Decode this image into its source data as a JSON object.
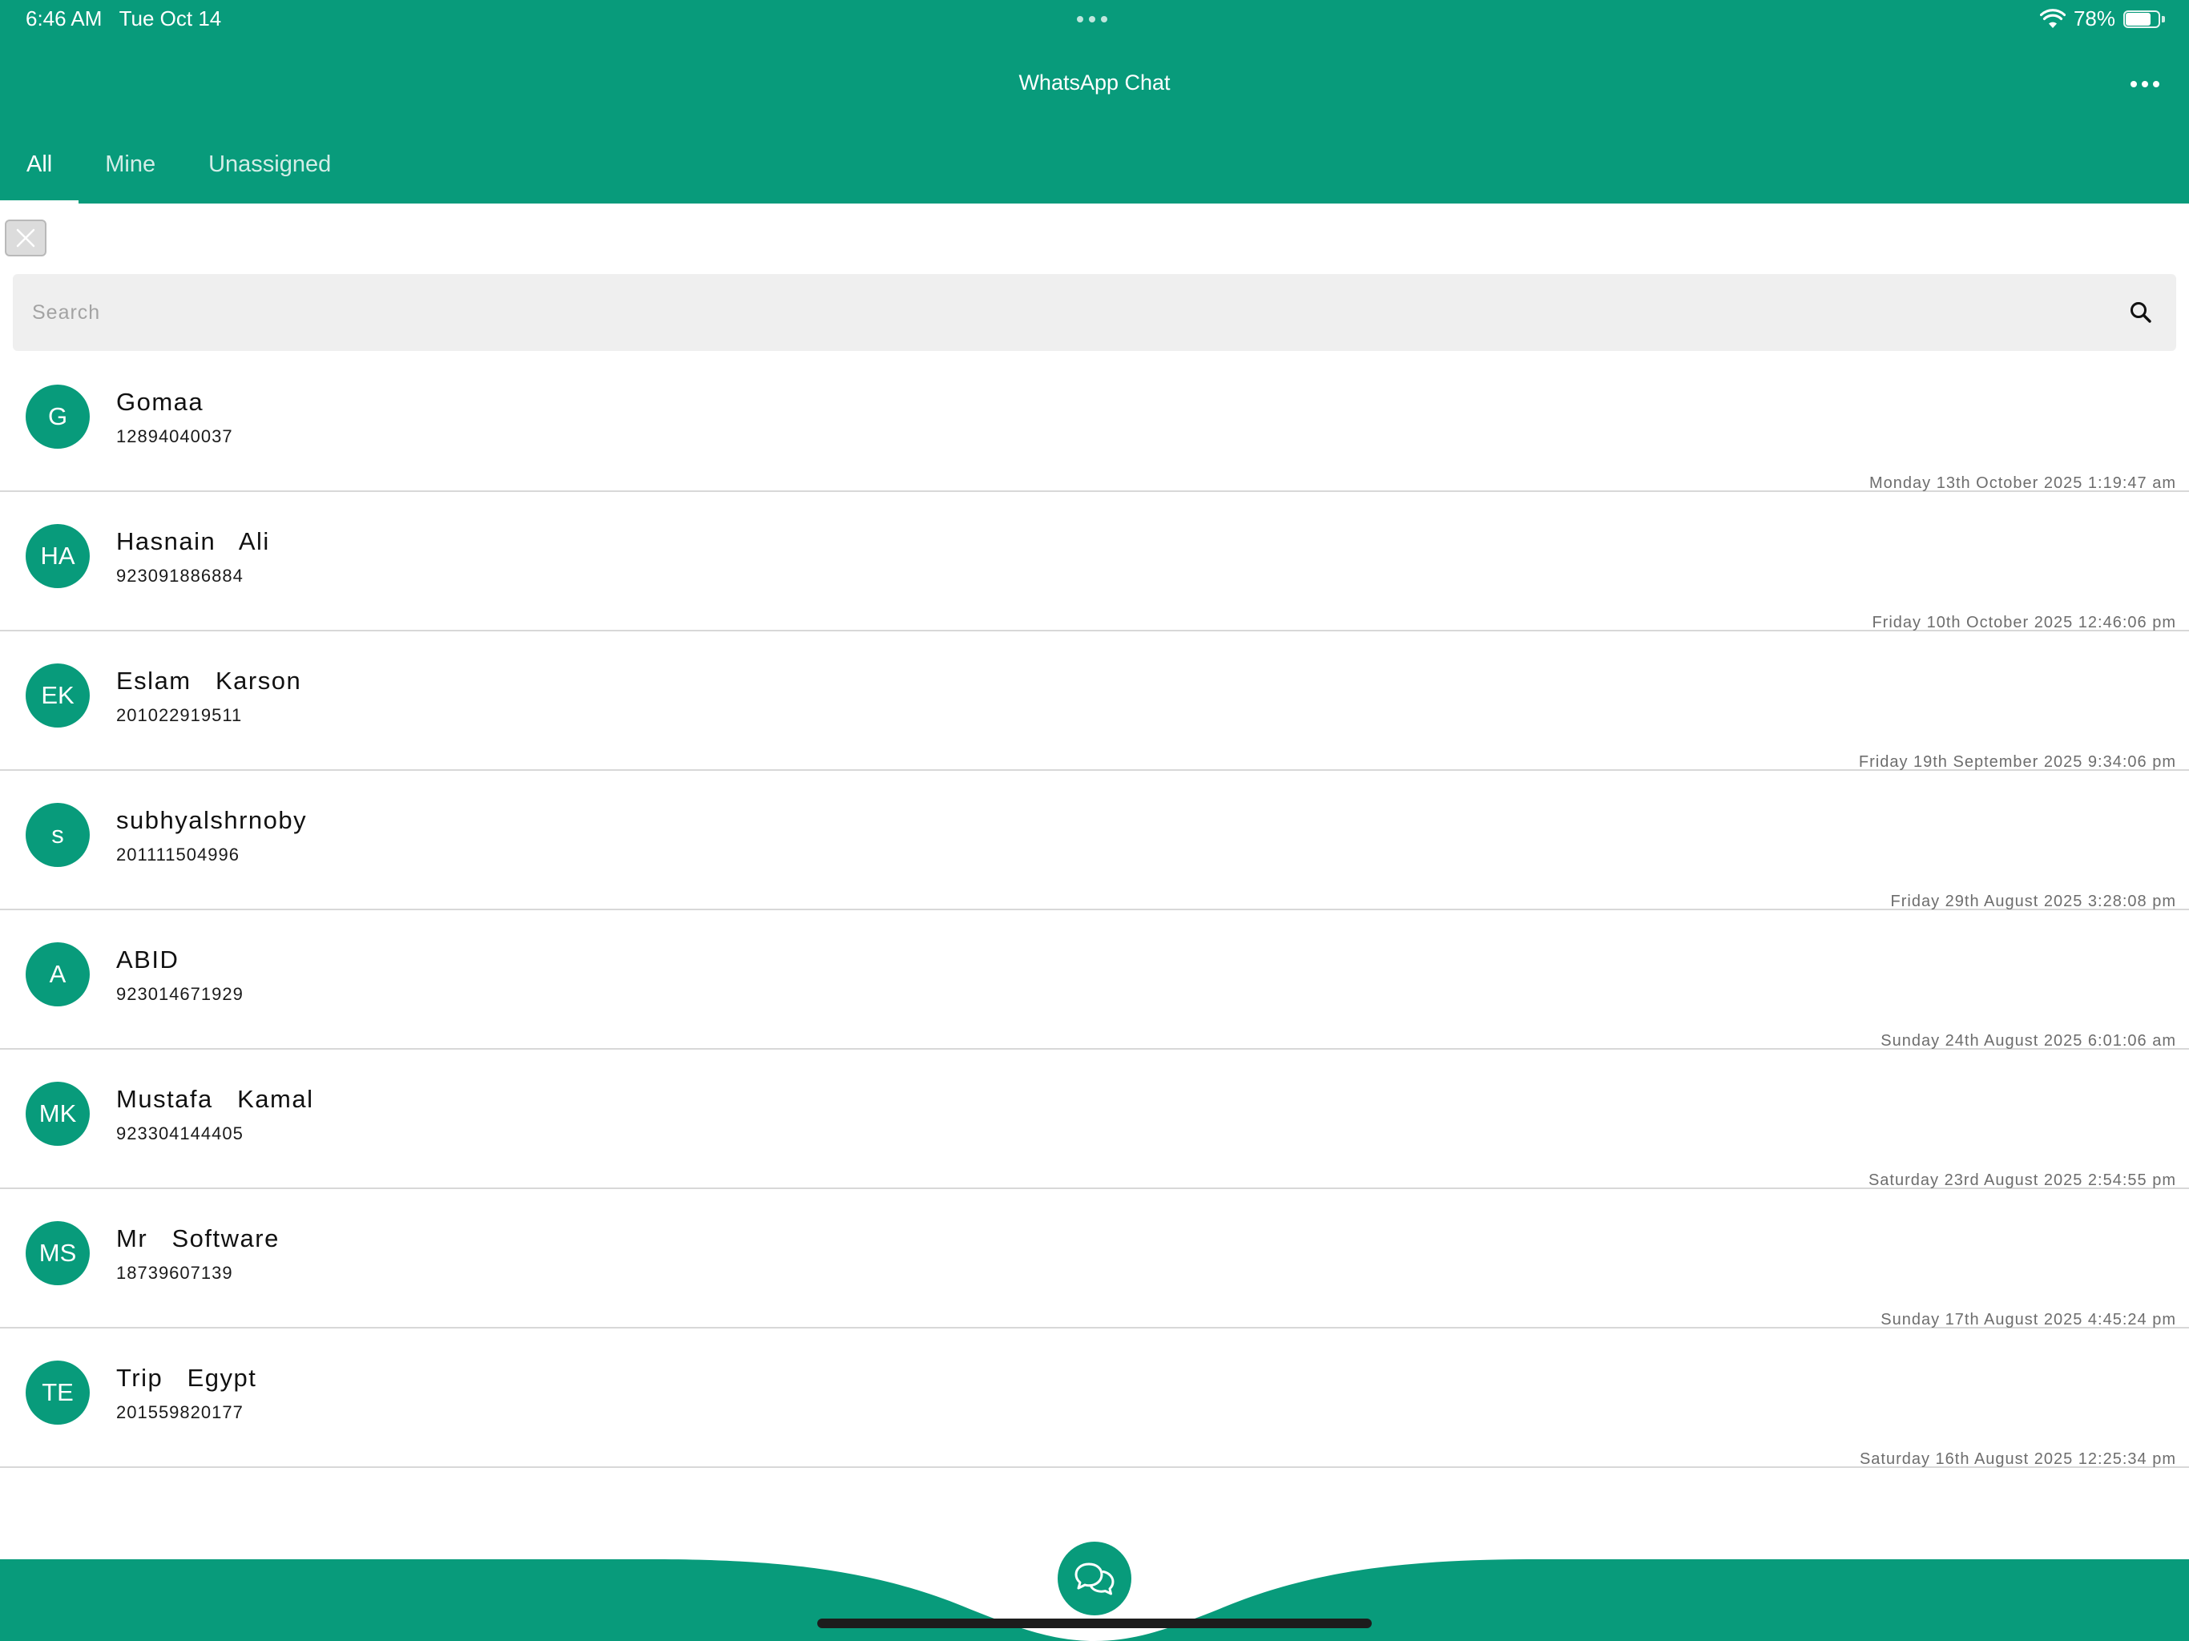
{
  "status_bar": {
    "time": "6:46 AM",
    "date": "Tue Oct 14",
    "battery_text": "78%",
    "battery_level": 0.78
  },
  "header": {
    "title": "WhatsApp Chat",
    "menu_icon": "more-horizontal-icon"
  },
  "tabs": [
    {
      "label": "All",
      "active": true
    },
    {
      "label": "Mine",
      "active": false
    },
    {
      "label": "Unassigned",
      "active": false
    }
  ],
  "search": {
    "placeholder": "Search",
    "value": "",
    "icon": "search-icon"
  },
  "contacts": [
    {
      "initials": "G",
      "name": "Gomaa",
      "phone": "12894040037",
      "timestamp": "Monday 13th October 2025 1:19:47 am"
    },
    {
      "initials": "HA",
      "name": "Hasnain   Ali",
      "phone": "923091886884",
      "timestamp": "Friday 10th October 2025 12:46:06 pm"
    },
    {
      "initials": "EK",
      "name": "Eslam   Karson",
      "phone": "201022919511",
      "timestamp": "Friday 19th September 2025 9:34:06 pm"
    },
    {
      "initials": "s",
      "name": "subhyalshrnoby",
      "phone": "201111504996",
      "timestamp": "Friday 29th August 2025 3:28:08 pm"
    },
    {
      "initials": "A",
      "name": "ABID",
      "phone": "923014671929",
      "timestamp": "Sunday 24th August 2025 6:01:06 am"
    },
    {
      "initials": "MK",
      "name": "Mustafa   Kamal",
      "phone": "923304144405",
      "timestamp": "Saturday 23rd August 2025 2:54:55 pm"
    },
    {
      "initials": "MS",
      "name": "Mr   Software",
      "phone": "18739607139",
      "timestamp": "Sunday 17th August 2025 4:45:24 pm"
    },
    {
      "initials": "TE",
      "name": "Trip   Egypt",
      "phone": "201559820177",
      "timestamp": "Saturday 16th August 2025 12:25:34 pm"
    }
  ],
  "colors": {
    "brand": "#089b7b",
    "divider": "#d8d8d8",
    "timestamp": "#6d6d6d"
  }
}
